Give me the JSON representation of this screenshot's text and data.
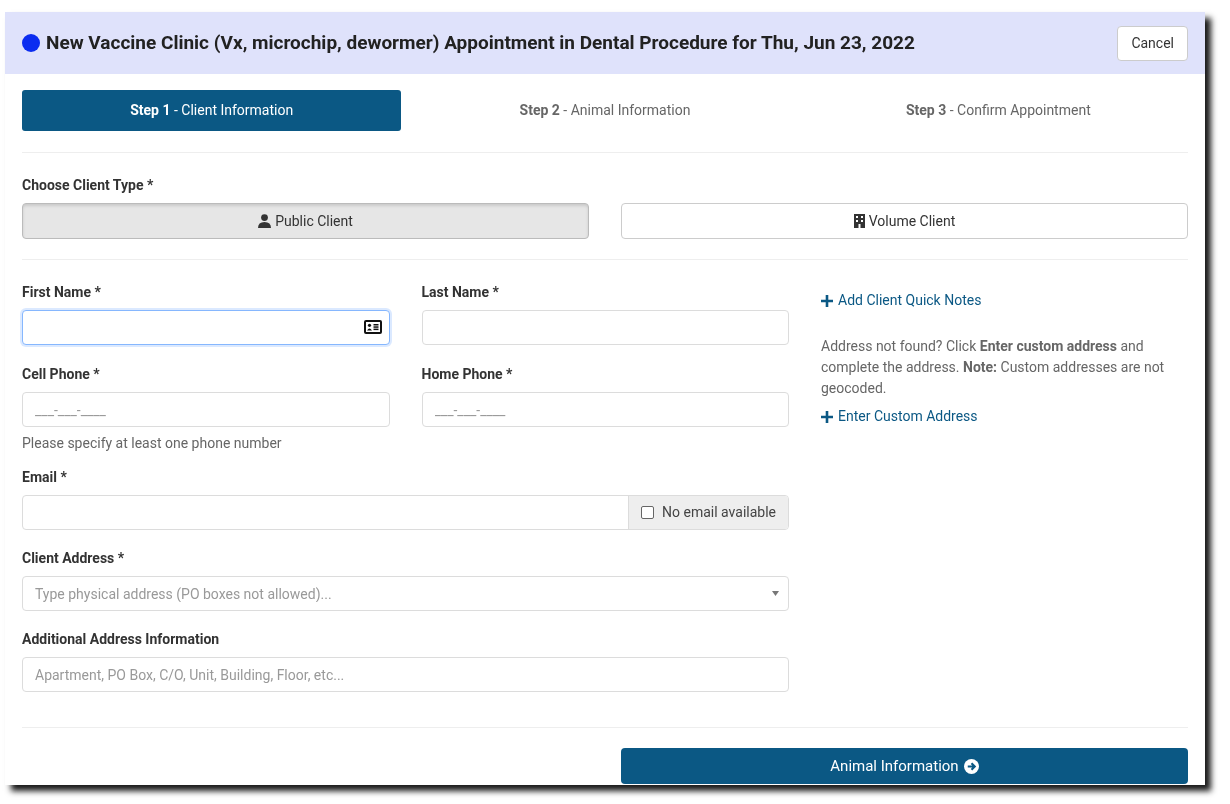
{
  "header": {
    "title": "New Vaccine Clinic (Vx, microchip, dewormer) Appointment in Dental Procedure for Thu, Jun 23, 2022",
    "cancel": "Cancel"
  },
  "steps": [
    {
      "label": "**Step 1** - Client Information",
      "selected": true
    },
    {
      "label": "**Step 2** - Animal Information",
      "selected": false
    },
    {
      "label": "**Step 3** - Confirm Appointment",
      "selected": false
    }
  ],
  "client_type": {
    "label": "Choose Client Type *",
    "options": [
      {
        "label": "Public Client",
        "kind": "person",
        "selected": true
      },
      {
        "label": "Volume Client",
        "kind": "building",
        "selected": false
      }
    ]
  },
  "first_name": {
    "label": "First Name *",
    "focused": true
  },
  "last_name": {
    "label": "Last Name *"
  },
  "cell_phone": {
    "label": "Cell Phone *",
    "placeholder": "___-___-____"
  },
  "home_phone": {
    "label": "Home Phone *",
    "placeholder": "___-___-____"
  },
  "phone_hint": "Please specify at least one phone number",
  "email": {
    "label": "Email *",
    "no_email": {
      "label": "No email available",
      "checked": false
    }
  },
  "address": {
    "label": "Client Address *",
    "placeholder": "Type physical address (PO boxes not allowed)..."
  },
  "additional": {
    "label": "Additional Address Information",
    "placeholder": "Apartment, PO Box, C/O, Unit, Building, Floor, etc..."
  },
  "side": {
    "quick_notes": "Add Client Quick Notes",
    "note": "Address not found? Click **Enter custom address** and complete the address. **Note:** Custom addresses are not geocoded.",
    "custom_address": "Enter Custom Address"
  },
  "next_button": "Animal Information"
}
